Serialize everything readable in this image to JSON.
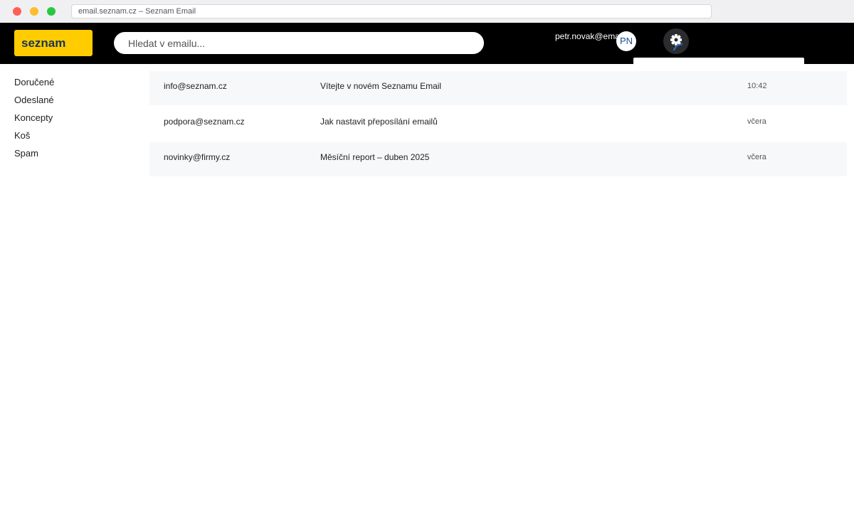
{
  "browser": {
    "url": "email.seznam.cz – Seznam Email"
  },
  "header": {
    "logo": "seznam",
    "search_placeholder": "Hledat v emailu...",
    "user_email": "petr.novak@email.cz",
    "avatar_initials": "PN",
    "icons": {
      "settings": "gear-icon"
    },
    "colors": {
      "header_bg": "#000000",
      "logo_bg": "#ffcc00",
      "logo_text": "#1a3550"
    }
  },
  "sidebar": {
    "items": [
      {
        "label": "Doručené"
      },
      {
        "label": "Odeslané"
      },
      {
        "label": "Koncepty"
      },
      {
        "label": "Koš"
      },
      {
        "label": "Spam"
      }
    ]
  },
  "messages": [
    {
      "sender": "info@seznam.cz",
      "subject": "Vítejte v novém Seznamu Email",
      "time": "10:42"
    },
    {
      "sender": "podpora@seznam.cz",
      "subject": "Jak nastavit přeposílání emailů",
      "time": "včera"
    },
    {
      "sender": "novinky@firmy.cz",
      "subject": "Měsíční report – duben 2025",
      "time": "včera"
    }
  ]
}
